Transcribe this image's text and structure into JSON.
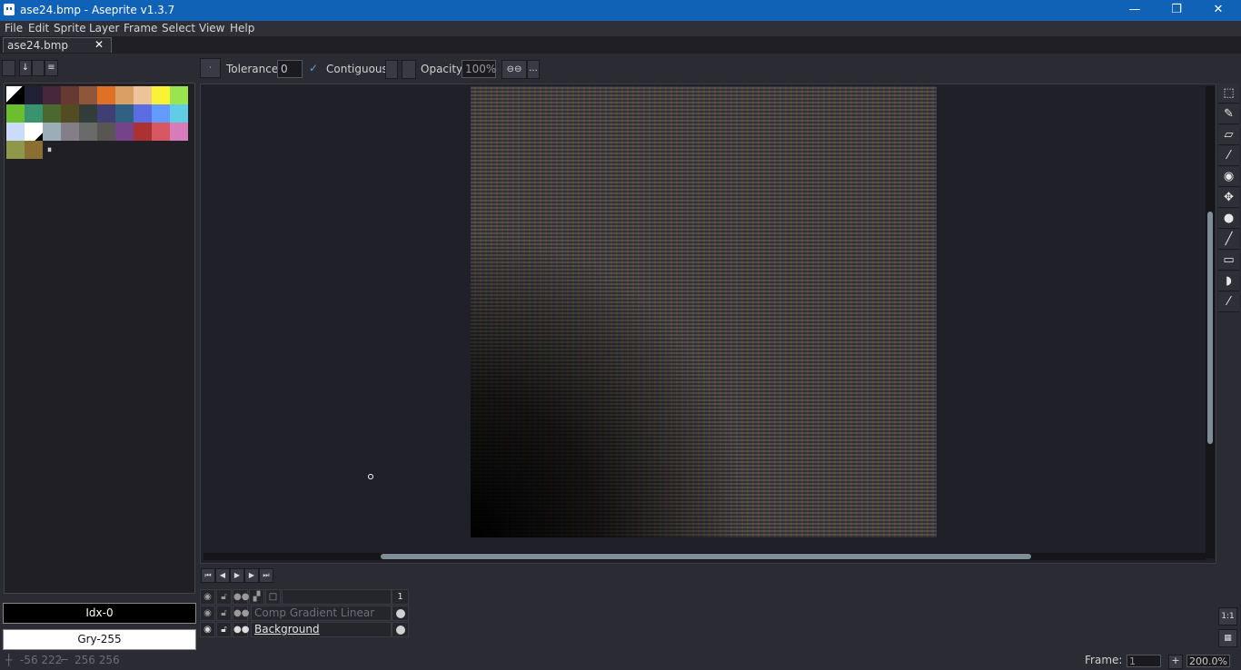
{
  "window": {
    "title": "ase24.bmp - Aseprite v1.3.7",
    "minimize": "—",
    "maximize": "❐",
    "close": "✕"
  },
  "menu": [
    "File",
    "Edit",
    "Sprite",
    "Layer",
    "Frame",
    "Select",
    "View",
    "Help"
  ],
  "tab": {
    "label": "ase24.bmp",
    "close": "✕"
  },
  "context": {
    "tolerance_label": "Tolerance:",
    "tolerance_value": "0",
    "contiguous_label": "Contiguous",
    "contiguous_checked": true,
    "opacity_label": "Opacity:",
    "opacity_value": "100%",
    "more": "..."
  },
  "palette": {
    "colors": [
      "#000000",
      "#222034",
      "#45283c",
      "#663931",
      "#8f563b",
      "#df7126",
      "#d9a066",
      "#eec39a",
      "#fbf236",
      "#99e550",
      "#6abe30",
      "#37946e",
      "#4b692f",
      "#524b24",
      "#323c39",
      "#3f3f74",
      "#306082",
      "#5b6ee1",
      "#639bff",
      "#5fcde4",
      "#cbdbfc",
      "#ffffff",
      "#9badb7",
      "#847e87",
      "#696a6a",
      "#595652",
      "#76428a",
      "#ac3232",
      "#d95763",
      "#d77bba",
      "#8f974a",
      "#8a6f30"
    ],
    "selected_index": 0
  },
  "colorbar": {
    "fg_label": "Idx-0",
    "bg_label": "Gry-255"
  },
  "tools": [
    "rect-select",
    "pencil",
    "eraser",
    "eyedropper",
    "zoom",
    "move",
    "paint-bucket",
    "line",
    "rectangle",
    "contour",
    "blur"
  ],
  "timeline": {
    "frame_header": "1",
    "layers": [
      {
        "name": "Comp Gradient Linear SR_L",
        "active": false
      },
      {
        "name": "Background",
        "active": true
      }
    ],
    "zoom_btn": "1:1"
  },
  "status": {
    "cursor": "-56 222",
    "size": "256 256",
    "frame_label": "Frame:",
    "frame_value": "1",
    "add_frame": "+",
    "zoom": "200.0%"
  },
  "colors": {
    "titlebar": "#0f62b5",
    "accent_scroll": "#7f8e96"
  }
}
